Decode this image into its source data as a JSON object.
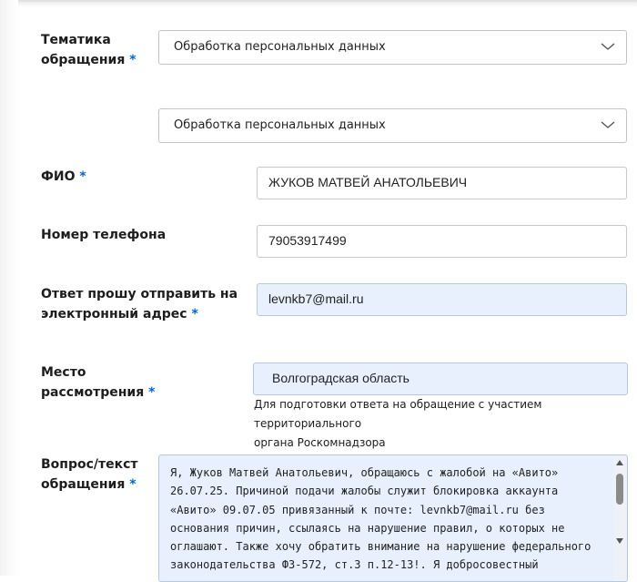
{
  "topic": {
    "label_line1": "Тематика",
    "label_line2": "обращения",
    "required_mark": "*",
    "select1_value": "Обработка персональных данных",
    "select2_value": "Обработка персональных данных"
  },
  "fio": {
    "label": "ФИО",
    "required_mark": "*",
    "value": "ЖУКОВ МАТВЕЙ АНАТОЛЬЕВИЧ"
  },
  "phone": {
    "label": "Номер телефона",
    "value": "79053917499"
  },
  "email": {
    "label_line1": "Ответ прошу отправить на",
    "label_line2": "электронный адрес",
    "required_mark": "*",
    "value": "levnkb7@mail.ru"
  },
  "place": {
    "label_line1": "Место",
    "label_line2": "рассмотрения",
    "required_mark": "*",
    "value": "Волгоградская область",
    "hint_line1": "Для подготовки ответа на обращение с участием территориального",
    "hint_line2": "органа Роскомнадзора"
  },
  "question": {
    "label_line1": "Вопрос/текст",
    "label_line2": "обращения",
    "required_mark": "*",
    "text": "Я, Жуков Матвей Анатольевич, обращаюсь с жалобой на «Авито» 26.07.25. Причиной подачи жалобы служит блокировка аккаунта «Авито» 09.07.05 привязанный к почте: levnkb7@mail.ru  без основания причин, ссылаясь на нарушение правил, о которых не оглашают. Также хочу обратить внимание на нарушение федерального законодательства ФЗ-572, ст.3 п.12-13!. Я добросовестный"
  },
  "colors": {
    "required": "#0066cc",
    "filled_field_bg": "#e8f0fe"
  },
  "icons": {
    "select_chevron": "chevron-down-icon",
    "scroll_up": "scroll-up-arrow-icon",
    "scroll_down": "scroll-down-arrow-icon"
  }
}
